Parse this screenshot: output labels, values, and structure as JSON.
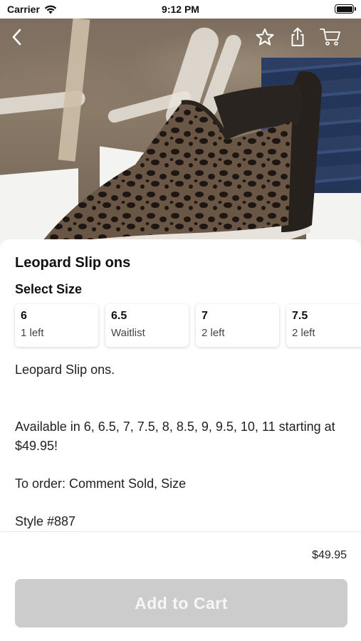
{
  "status_bar": {
    "carrier": "Carrier",
    "time": "9:12 PM"
  },
  "nav": {
    "icons": [
      "back-chevron-icon",
      "star-icon",
      "share-icon",
      "cart-icon"
    ]
  },
  "product": {
    "title": "Leopard Slip ons",
    "select_size_label": "Select Size",
    "sizes": [
      {
        "size": "6",
        "stock": "1 left"
      },
      {
        "size": "6.5",
        "stock": "Waitlist"
      },
      {
        "size": "7",
        "stock": "2 left"
      },
      {
        "size": "7.5",
        "stock": "2 left"
      }
    ],
    "description": [
      "Leopard Slip ons.",
      "",
      "Available in 6, 6.5, 7, 7.5, 8, 8.5, 9, 9.5, 10, 11 starting at $49.95!",
      "To order: Comment Sold, Size",
      "Style #887"
    ]
  },
  "footer": {
    "price": "$49.95",
    "add_to_cart_label": "Add to Cart",
    "add_to_cart_disabled": true
  },
  "colors": {
    "button_disabled": "#cccccc",
    "button_text": "#f6f6f6",
    "accent_text": "#111111"
  }
}
